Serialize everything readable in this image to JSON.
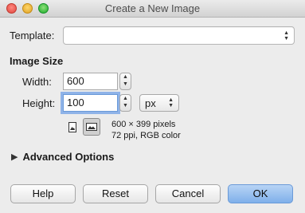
{
  "window": {
    "title": "Create a New Image"
  },
  "template": {
    "label": "Template:",
    "value": ""
  },
  "image_size": {
    "heading": "Image Size",
    "width_label": "Width:",
    "width_value": "600",
    "height_label": "Height:",
    "height_value": "100",
    "unit": "px"
  },
  "info": {
    "line1": "600 × 399 pixels",
    "line2": "72 ppi, RGB color"
  },
  "advanced": {
    "label": "Advanced Options"
  },
  "buttons": {
    "help": "Help",
    "reset": "Reset",
    "cancel": "Cancel",
    "ok": "OK"
  },
  "colors": {
    "ok_button": "#7fb0ea",
    "focus_ring": "#8fb3e8"
  }
}
